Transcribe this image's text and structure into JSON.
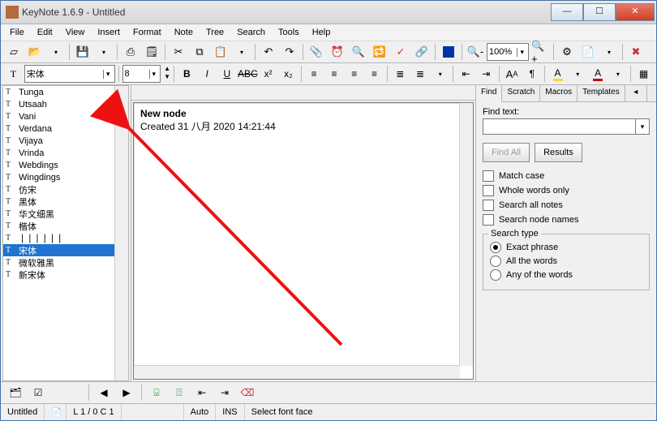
{
  "title": "KeyNote 1.6.9 - Untitled",
  "menu": [
    "File",
    "Edit",
    "View",
    "Insert",
    "Format",
    "Note",
    "Tree",
    "Search",
    "Tools",
    "Help"
  ],
  "toolbar1": {
    "zoom": "100%"
  },
  "fmt": {
    "font_name": "宋体",
    "font_size": "8"
  },
  "font_list": [
    {
      "label": "Tunga"
    },
    {
      "label": "Utsaah"
    },
    {
      "label": "Vani"
    },
    {
      "label": "Verdana"
    },
    {
      "label": "Vijaya"
    },
    {
      "label": "Vrinda"
    },
    {
      "label": "Webdings"
    },
    {
      "label": "Wingdings"
    },
    {
      "label": "仿宋"
    },
    {
      "label": "黑体"
    },
    {
      "label": "华文细黑"
    },
    {
      "label": "楷体"
    },
    {
      "label": "❘❘❘❘❘❘"
    },
    {
      "label": "宋体",
      "selected": true
    },
    {
      "label": "微软雅黑"
    },
    {
      "label": "新宋体"
    }
  ],
  "editor": {
    "heading": "New node",
    "created": "Created 31 八月 2020 14:21:44"
  },
  "right": {
    "tabs": [
      "Find",
      "Scratch",
      "Macros",
      "Templates"
    ],
    "active_tab": 0,
    "find_label": "Find text:",
    "btn_find_all": "Find All",
    "btn_results": "Results",
    "chk_match_case": "Match case",
    "chk_whole_words": "Whole words only",
    "chk_all_notes": "Search all notes",
    "chk_node_names": "Search node names",
    "grp_label": "Search type",
    "rad_exact": "Exact phrase",
    "rad_all": "All the words",
    "rad_any": "Any of the words"
  },
  "status": {
    "doc": "Untitled",
    "pos": "L 1 / 0  C 1",
    "auto": "Auto",
    "ins": "INS",
    "hint": "Select font face"
  }
}
